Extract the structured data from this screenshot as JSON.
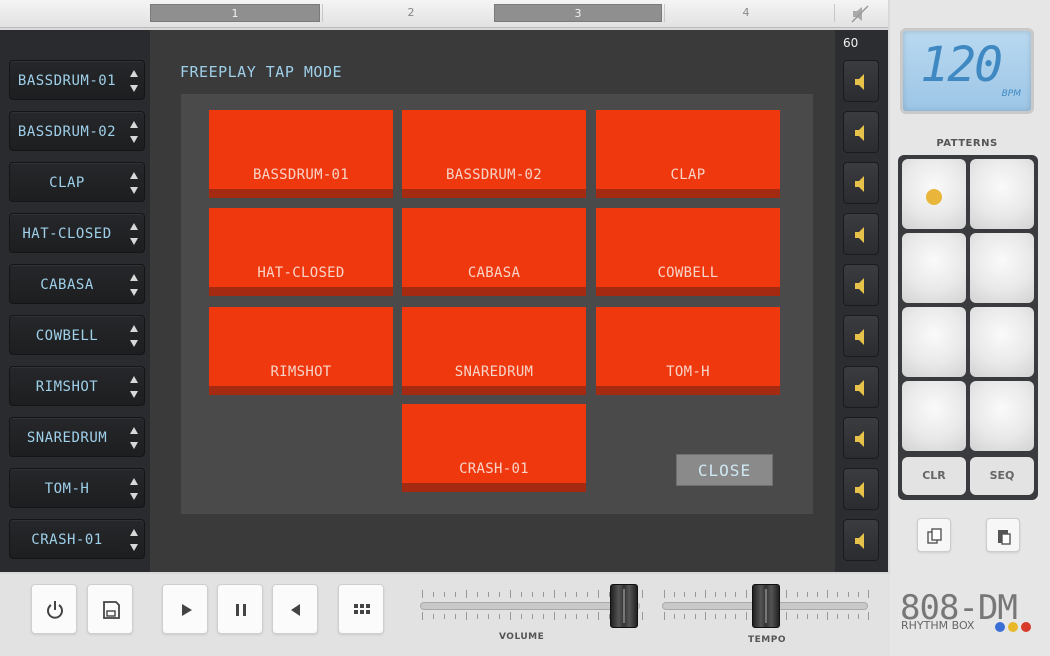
{
  "pages": [
    {
      "label": "1",
      "active": true
    },
    {
      "label": "2",
      "active": false
    },
    {
      "label": "3",
      "active": true
    },
    {
      "label": "4",
      "active": false
    }
  ],
  "instruments": [
    "BASSDRUM-01",
    "BASSDRUM-02",
    "CLAP",
    "HAT-CLOSED",
    "CABASA",
    "COWBELL",
    "RIMSHOT",
    "SNAREDRUM",
    "TOM-H",
    "CRASH-01"
  ],
  "modal": {
    "title": "FREEPLAY TAP MODE",
    "pads": [
      "BASSDRUM-01",
      "BASSDRUM-02",
      "CLAP",
      "HAT-CLOSED",
      "CABASA",
      "COWBELL",
      "RIMSHOT",
      "SNAREDRUM",
      "TOM-H",
      "CRASH-01"
    ],
    "close_label": "CLOSE"
  },
  "speaker_column": {
    "top_value": "60"
  },
  "lcd": {
    "value": "120",
    "unit": "BPM"
  },
  "patterns": {
    "label": "PATTERNS",
    "active_index": 0,
    "clr_label": "CLR",
    "seq_label": "SEQ"
  },
  "sliders": {
    "volume": {
      "label": "VOLUME",
      "level": 0.9
    },
    "tempo": {
      "label": "TEMPO",
      "level": 0.5
    }
  },
  "brand": {
    "name": "808-DM",
    "subtitle": "RHYTHM BOX",
    "dots": [
      "#3a6fd8",
      "#e8b82a",
      "#d83a2a"
    ]
  },
  "colors": {
    "pad": "#f0380e",
    "lcd_text": "#3f88c2",
    "led": "#e9b63b",
    "label_text": "#9fd0ea"
  }
}
